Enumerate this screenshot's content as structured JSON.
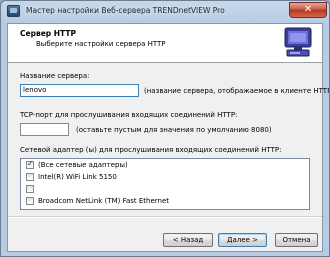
{
  "window": {
    "title": "Мастер настройки Веб-сервера TRENDnetVIEW Pro",
    "close_glyph": "✕"
  },
  "header": {
    "title": "Сервер HTTP",
    "subtitle": "Выберите настройки сервера HTTP",
    "icon": "server-wizard-icon"
  },
  "server_name": {
    "label": "Название сервера:",
    "value": "lenovo",
    "hint": "(название сервера, отображаемое в клиенте HTTP)"
  },
  "port": {
    "label": "TCP-порт для прослушивания входящих соединений HTTP:",
    "value": "",
    "hint": "(оставьте пустым для значения по умолчанию 8080)"
  },
  "adapters": {
    "label": "Сетевой адаптер (ы) для прослушивания входящих соединений HTTP:",
    "items": [
      {
        "label": "(Все сетевые адаптеры)",
        "checked": true
      },
      {
        "label": "Intel(R) WiFi Link 5150",
        "checked": false
      },
      {
        "label": "",
        "checked": false
      },
      {
        "label": "Broadcom NetLink (TM) Fast Ethernet",
        "checked": false
      }
    ]
  },
  "buttons": {
    "back": "< Назад",
    "next": "Далее >",
    "cancel": "Отмена"
  }
}
